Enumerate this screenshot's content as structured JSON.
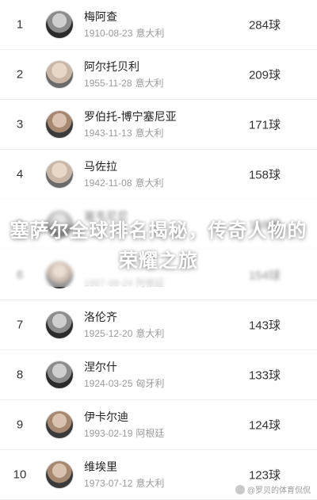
{
  "players": [
    {
      "rank": "1",
      "name": "梅阿查",
      "birth": "1910-08-23",
      "country": "意大利",
      "goals": "284球"
    },
    {
      "rank": "2",
      "name": "阿尔托贝利",
      "birth": "1955-11-28",
      "country": "意大利",
      "goals": "209球"
    },
    {
      "rank": "3",
      "name": "罗伯托-博宁塞尼亚",
      "birth": "1943-11-13",
      "country": "意大利",
      "goals": "171球"
    },
    {
      "rank": "4",
      "name": "马佐拉",
      "birth": "1942-11-08",
      "country": "意大利",
      "goals": "158球"
    },
    {
      "rank": "5",
      "name": "塞韦尼尼",
      "birth": "",
      "country": "",
      "goals": "158球"
    },
    {
      "rank": "6",
      "name": "",
      "birth": "1997-08-24",
      "country": "阿根廷",
      "goals": "154球"
    },
    {
      "rank": "7",
      "name": "洛伦齐",
      "birth": "1925-12-20",
      "country": "意大利",
      "goals": "143球"
    },
    {
      "rank": "8",
      "name": "涅尔什",
      "birth": "1924-03-25",
      "country": "匈牙利",
      "goals": "133球"
    },
    {
      "rank": "9",
      "name": "伊卡尔迪",
      "birth": "1993-02-19",
      "country": "阿根廷",
      "goals": "124球"
    },
    {
      "rank": "10",
      "name": "维埃里",
      "birth": "1973-07-12",
      "country": "意大利",
      "goals": "123球"
    }
  ],
  "overlay": {
    "title": "塞萨尔全球排名揭秘，传奇人物的荣耀之旅"
  },
  "watermark": {
    "text": "@罗贝的体育侃侃"
  }
}
